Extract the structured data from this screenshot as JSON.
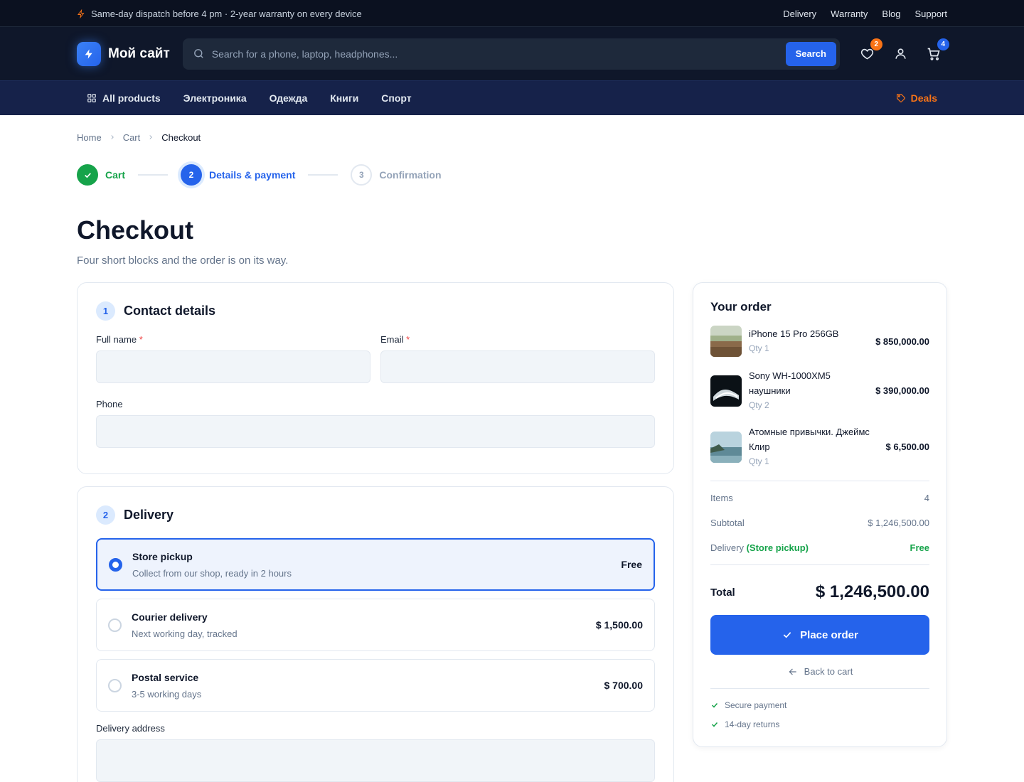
{
  "topbar": {
    "promo": "Same-day dispatch before 4 pm · 2-year warranty on every device",
    "links": [
      "Delivery",
      "Warranty",
      "Blog",
      "Support"
    ]
  },
  "header": {
    "logo_text": "Мой сайт",
    "search_placeholder": "Search for a phone, laptop, headphones...",
    "search_button": "Search",
    "wishlist_count": "2",
    "cart_count": "4"
  },
  "categories": {
    "all": "All products",
    "items": [
      "Электроника",
      "Одежда",
      "Книги",
      "Спорт"
    ],
    "deals": "Deals"
  },
  "breadcrumb": [
    "Home",
    "Cart",
    "Checkout"
  ],
  "steps": [
    {
      "num": "1",
      "label": "Cart",
      "state": "done"
    },
    {
      "num": "2",
      "label": "Details & payment",
      "state": "active"
    },
    {
      "num": "3",
      "label": "Confirmation",
      "state": "todo"
    }
  ],
  "page": {
    "title": "Checkout",
    "subtitle": "Four short blocks and the order is on its way."
  },
  "contact": {
    "num": "1",
    "title": "Contact details",
    "full_name_label": "Full name",
    "email_label": "Email",
    "phone_label": "Phone",
    "required_mark": "*"
  },
  "delivery": {
    "num": "2",
    "title": "Delivery",
    "options": [
      {
        "title": "Store pickup",
        "desc": "Collect from our shop, ready in 2 hours",
        "price": "Free",
        "selected": true
      },
      {
        "title": "Courier delivery",
        "desc": "Next working day, tracked",
        "price": "$ 1,500.00",
        "selected": false
      },
      {
        "title": "Postal service",
        "desc": "3-5 working days",
        "price": "$ 700.00",
        "selected": false
      }
    ],
    "address_label": "Delivery address"
  },
  "summary": {
    "title": "Your order",
    "items": [
      {
        "name": "iPhone 15 Pro 256GB",
        "qty": "Qty 1",
        "price": "$ 850,000.00"
      },
      {
        "name": "Sony WH-1000XM5 наушники",
        "qty": "Qty 2",
        "price": "$ 390,000.00"
      },
      {
        "name": "Атомные привычки. Джеймс Клир",
        "qty": "Qty 1",
        "price": "$ 6,500.00"
      }
    ],
    "items_label": "Items",
    "items_value": "4",
    "subtotal_label": "Subtotal",
    "subtotal_value": "$ 1,246,500.00",
    "delivery_label": "Delivery",
    "delivery_method": "(Store pickup)",
    "delivery_value": "Free",
    "total_label": "Total",
    "total_value": "$ 1,246,500.00",
    "place_order": "Place order",
    "back_to_cart": "Back to cart",
    "trust": [
      "Secure payment",
      "14-day returns"
    ]
  },
  "colors": {
    "accent": "#2563eb",
    "success": "#16a34a",
    "deals": "#f97316",
    "topbar_bg": "#0b1120",
    "header_bg": "#0f172a"
  }
}
